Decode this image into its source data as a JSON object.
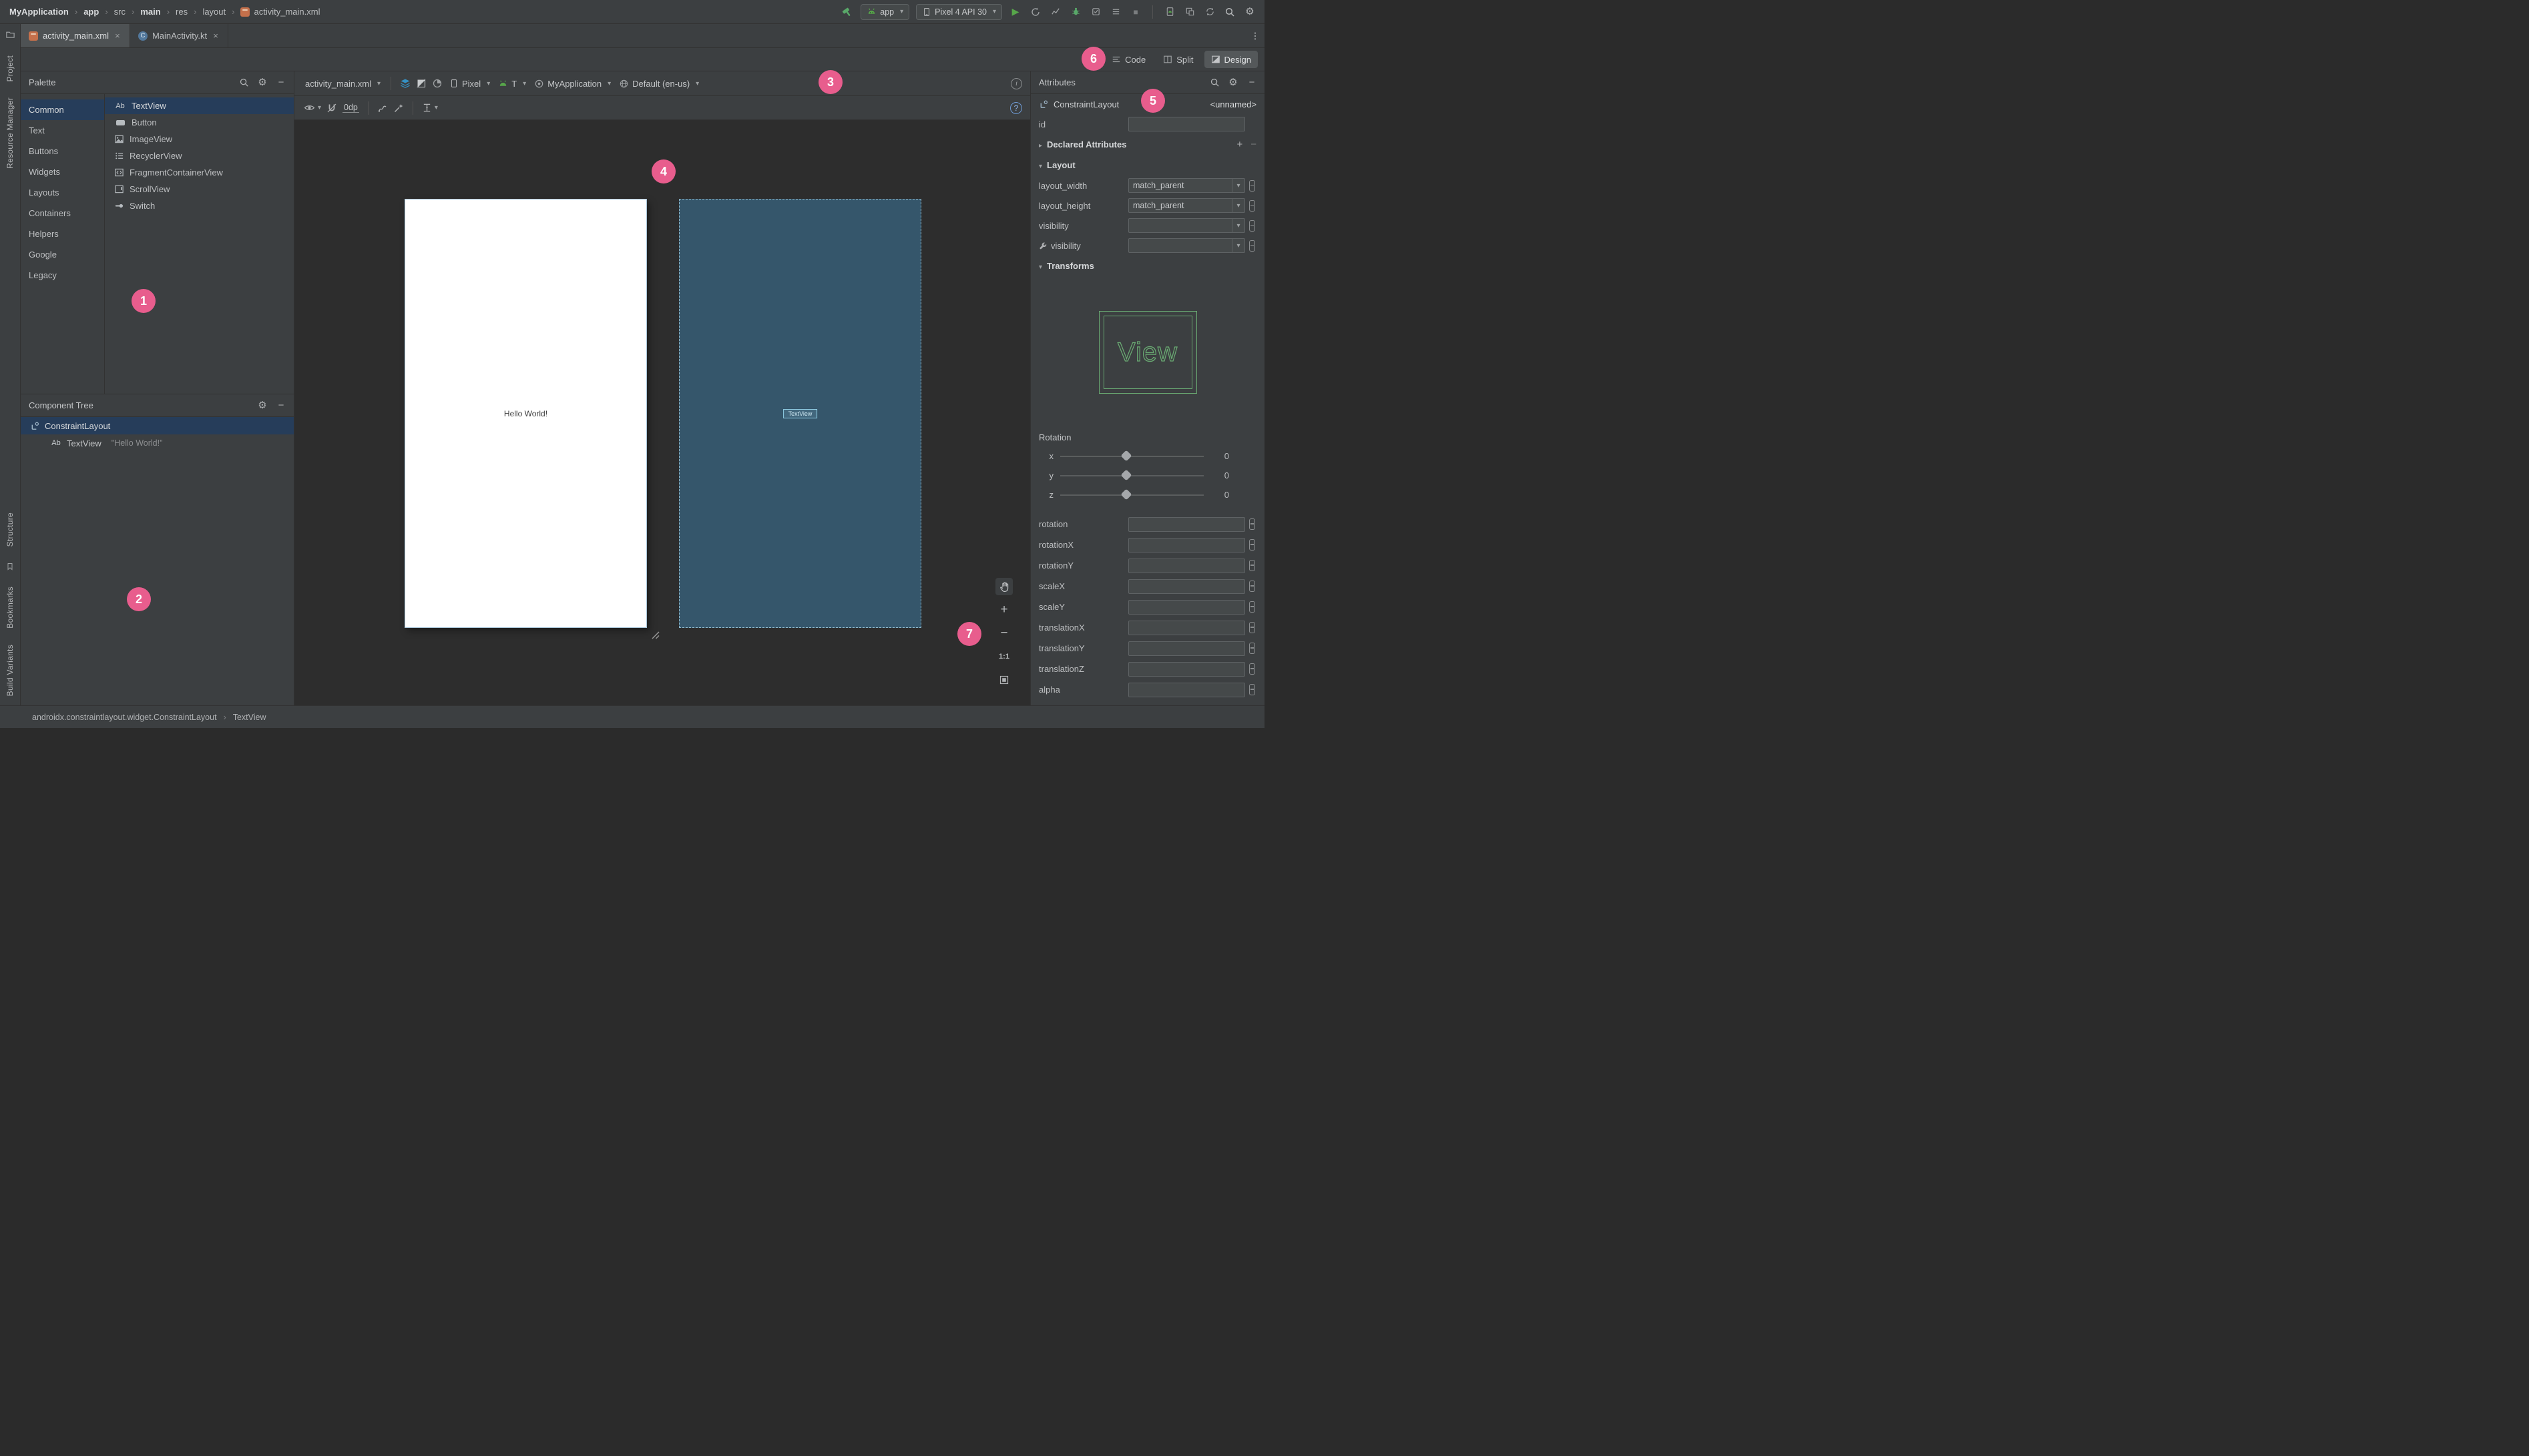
{
  "menu_bar": {
    "breadcrumbs": [
      "MyApplication",
      "app",
      "src",
      "main",
      "res",
      "layout",
      "activity_main.xml"
    ],
    "run_config": "app",
    "device": "Pixel 4 API 30"
  },
  "editor_tabs": [
    {
      "label": "activity_main.xml"
    },
    {
      "label": "MainActivity.kt"
    }
  ],
  "mode_switch": {
    "code": "Code",
    "split": "Split",
    "design": "Design"
  },
  "tool_stripes": {
    "project": "Project",
    "resource_manager": "Resource Manager",
    "structure": "Structure",
    "bookmarks": "Bookmarks",
    "build_variants": "Build Variants"
  },
  "palette": {
    "title": "Palette",
    "categories": [
      "Common",
      "Text",
      "Buttons",
      "Widgets",
      "Layouts",
      "Containers",
      "Helpers",
      "Google",
      "Legacy"
    ],
    "items": [
      "TextView",
      "Button",
      "ImageView",
      "RecyclerView",
      "FragmentContainerView",
      "ScrollView",
      "Switch"
    ],
    "textview_icon_label": "Ab"
  },
  "component_tree": {
    "title": "Component Tree",
    "root": "ConstraintLayout",
    "child": "TextView",
    "child_detail": "\"Hello World!\"",
    "child_icon_label": "Ab"
  },
  "design_toolbar": {
    "file": "activity_main.xml",
    "device": "Pixel",
    "api_level": "T",
    "theme": "MyApplication",
    "locale": "Default (en-us)",
    "default_margin": "0dp"
  },
  "canvas": {
    "design_text": "Hello World!",
    "blueprint_widget": "TextView",
    "zoom_reset": "1:1"
  },
  "attributes_panel": {
    "title": "Attributes",
    "component": "ConstraintLayout",
    "component_name": "<unnamed>",
    "id_label": "id",
    "id_value": "",
    "declared_section": "Declared Attributes",
    "layout_section": "Layout",
    "transforms_section": "Transforms",
    "layout_rows": [
      {
        "label": "layout_width",
        "value": "match_parent"
      },
      {
        "label": "layout_height",
        "value": "match_parent"
      },
      {
        "label": "visibility",
        "value": ""
      },
      {
        "label": "visibility",
        "value": ""
      }
    ],
    "view_preview": "View",
    "rotation_title": "Rotation",
    "sliders": [
      {
        "axis": "x",
        "value": "0"
      },
      {
        "axis": "y",
        "value": "0"
      },
      {
        "axis": "z",
        "value": "0"
      }
    ],
    "transform_fields": [
      "rotation",
      "rotationX",
      "rotationY",
      "scaleX",
      "scaleY",
      "translationX",
      "translationY",
      "translationZ",
      "alpha"
    ]
  },
  "status_bar": {
    "class_path": "androidx.constraintlayout.widget.ConstraintLayout",
    "selected": "TextView"
  },
  "annotations": [
    "1",
    "2",
    "3",
    "4",
    "5",
    "6",
    "7"
  ]
}
